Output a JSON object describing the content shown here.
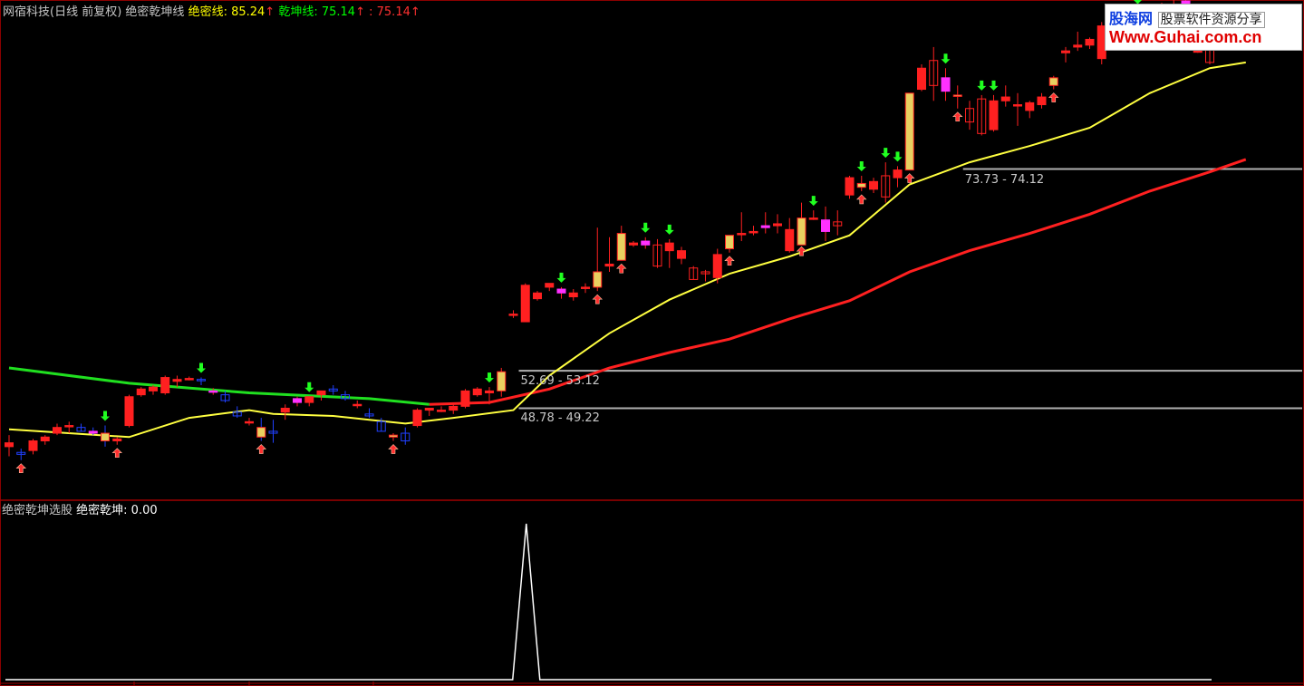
{
  "header": {
    "title": "网宿科技(日线 前复权) 绝密乾坤线",
    "line1_label": "绝密线: ",
    "line1_value": "85.24",
    "line2_label": "乾坤线: ",
    "line2_value": "75.14",
    "line3_label": ": ",
    "line3_value": "75.14",
    "up_arrow": "↑",
    "colors": {
      "title": "#c8c8c8",
      "line1": "#ffff00",
      "line2": "#00ff00",
      "line3": "#ff3030"
    }
  },
  "watermark": {
    "brand": "股海网",
    "slogan": "股票软件资源分享",
    "url": "Www.Guhai.com.cn"
  },
  "indicator": {
    "title": "绝密乾坤选股",
    "label": "绝密乾坤: ",
    "value": "0.00"
  },
  "range_labels": [
    {
      "text": "52.69 - 53.12",
      "price": 53.1
    },
    {
      "text": "48.78 - 49.22",
      "price": 49.2
    },
    {
      "text": "73.73 - 74.12",
      "price": 74.1
    }
  ],
  "chart_data": {
    "type": "candlestick",
    "price_range": [
      40,
      90
    ],
    "colors": {
      "up": "#ff2020",
      "down_early": "#2040ff",
      "ma_fast": "#ffff40",
      "ma_slow_green": "#20e020",
      "ma_slow_red": "#ff2020",
      "highlight_gold": "#e8d060",
      "highlight_magenta": "#ff30ff",
      "signal_down": "#20ff20",
      "signal_up": "#ff3030",
      "indicator_line": "#ffffff"
    },
    "candles": [
      [
        45.2,
        46.4,
        44.2,
        45.6
      ],
      [
        44.6,
        45.0,
        43.8,
        44.4
      ],
      [
        44.8,
        46.0,
        44.4,
        45.8
      ],
      [
        45.8,
        46.4,
        45.4,
        46.2
      ],
      [
        46.6,
        47.6,
        46.4,
        47.2
      ],
      [
        47.4,
        47.8,
        46.6,
        47.4
      ],
      [
        47.2,
        47.6,
        46.8,
        46.8
      ],
      [
        46.8,
        47.2,
        46.4,
        46.6
      ],
      [
        46.6,
        47.4,
        45.2,
        45.8
      ],
      [
        45.8,
        46.2,
        45.4,
        46.0
      ],
      [
        47.4,
        50.6,
        47.2,
        50.4
      ],
      [
        50.6,
        51.4,
        50.4,
        51.2
      ],
      [
        51.0,
        51.6,
        50.6,
        51.4
      ],
      [
        50.8,
        52.6,
        50.6,
        52.4
      ],
      [
        52.0,
        52.6,
        51.4,
        52.2
      ],
      [
        52.3,
        52.5,
        52.1,
        52.3
      ],
      [
        52.2,
        52.4,
        51.6,
        52.1
      ],
      [
        51.0,
        51.3,
        50.6,
        51.0
      ],
      [
        50.6,
        51.0,
        49.8,
        50.0
      ],
      [
        48.8,
        49.4,
        48.2,
        48.4
      ],
      [
        47.8,
        48.2,
        47.4,
        47.8
      ],
      [
        47.2,
        48.2,
        45.8,
        46.2
      ],
      [
        46.8,
        48.0,
        45.6,
        46.6
      ],
      [
        48.8,
        49.6,
        48.0,
        49.2
      ],
      [
        49.8,
        50.4,
        49.4,
        50.2
      ],
      [
        49.8,
        50.4,
        49.4,
        50.4
      ],
      [
        50.6,
        51.0,
        50.0,
        51.0
      ],
      [
        51.2,
        51.6,
        50.6,
        51.0
      ],
      [
        50.6,
        51.0,
        50.0,
        50.2
      ],
      [
        49.6,
        50.0,
        49.2,
        49.6
      ],
      [
        48.6,
        49.2,
        48.2,
        48.4
      ],
      [
        47.8,
        48.2,
        46.8,
        46.8
      ],
      [
        46.2,
        46.6,
        45.8,
        46.4
      ],
      [
        46.6,
        47.2,
        45.4,
        45.8
      ],
      [
        47.4,
        49.2,
        47.2,
        49.0
      ],
      [
        49.0,
        49.2,
        48.4,
        49.2
      ],
      [
        49.0,
        49.4,
        48.8,
        49.0
      ],
      [
        49.0,
        49.6,
        48.6,
        49.4
      ],
      [
        49.4,
        51.2,
        49.2,
        51.0
      ],
      [
        50.6,
        51.4,
        50.4,
        51.2
      ],
      [
        50.8,
        51.4,
        49.6,
        51.0
      ],
      [
        51.0,
        53.4,
        50.4,
        53.0
      ],
      [
        59.0,
        59.4,
        58.6,
        59.0
      ],
      [
        58.2,
        62.2,
        58.2,
        62.0
      ],
      [
        60.6,
        61.4,
        60.4,
        61.2
      ],
      [
        61.8,
        62.2,
        61.4,
        62.2
      ],
      [
        61.2,
        61.8,
        60.6,
        61.6
      ],
      [
        60.8,
        61.6,
        60.4,
        61.2
      ],
      [
        61.8,
        62.2,
        61.2,
        61.8
      ],
      [
        63.4,
        68.0,
        61.4,
        61.8
      ],
      [
        64.0,
        67.0,
        63.4,
        64.2
      ],
      [
        67.4,
        68.2,
        64.6,
        64.6
      ],
      [
        66.2,
        66.6,
        66.0,
        66.4
      ],
      [
        66.2,
        67.0,
        65.8,
        66.6
      ],
      [
        66.2,
        66.8,
        63.8,
        64.0
      ],
      [
        65.6,
        66.8,
        63.8,
        66.4
      ],
      [
        64.8,
        66.0,
        64.2,
        65.6
      ],
      [
        63.8,
        64.0,
        62.6,
        62.6
      ],
      [
        63.4,
        63.6,
        62.4,
        63.2
      ],
      [
        62.8,
        65.8,
        62.2,
        65.2
      ],
      [
        65.8,
        67.2,
        65.4,
        67.2
      ],
      [
        67.4,
        69.6,
        66.6,
        67.4
      ],
      [
        67.6,
        68.2,
        67.2,
        67.6
      ],
      [
        68.2,
        69.6,
        67.4,
        68.0
      ],
      [
        68.2,
        69.4,
        67.4,
        68.4
      ],
      [
        65.6,
        69.0,
        65.4,
        67.8
      ],
      [
        69.0,
        70.6,
        66.4,
        66.2
      ],
      [
        69.0,
        69.8,
        68.8,
        69.0
      ],
      [
        68.8,
        70.2,
        66.6,
        67.6
      ],
      [
        68.6,
        69.8,
        67.2,
        68.2
      ],
      [
        71.4,
        73.4,
        71.0,
        73.2
      ],
      [
        72.2,
        73.4,
        71.8,
        72.6
      ],
      [
        72.0,
        73.2,
        71.6,
        72.8
      ],
      [
        73.4,
        74.8,
        70.6,
        71.2
      ],
      [
        73.2,
        74.4,
        72.2,
        74.0
      ],
      [
        74.0,
        82.0,
        74.0,
        82.0
      ],
      [
        82.4,
        85.0,
        82.2,
        84.6
      ],
      [
        85.4,
        86.8,
        81.2,
        82.8
      ],
      [
        83.6,
        84.6,
        81.2,
        82.2
      ],
      [
        81.8,
        82.8,
        80.4,
        81.8
      ],
      [
        80.4,
        81.2,
        78.2,
        79.0
      ],
      [
        81.4,
        81.8,
        77.6,
        77.8
      ],
      [
        78.2,
        81.8,
        78.0,
        81.2
      ],
      [
        81.2,
        82.8,
        80.6,
        81.6
      ],
      [
        80.8,
        82.0,
        78.6,
        80.8
      ],
      [
        80.2,
        81.2,
        79.4,
        81.0
      ],
      [
        80.8,
        82.0,
        80.4,
        81.6
      ],
      [
        82.8,
        83.8,
        82.4,
        83.6
      ],
      [
        86.2,
        86.8,
        85.2,
        86.4
      ],
      [
        86.8,
        88.4,
        86.4,
        87.0
      ],
      [
        87.0,
        87.8,
        86.6,
        87.6
      ],
      [
        85.6,
        89.4,
        85.0,
        89.0
      ],
      [
        88.6,
        90.4,
        88.0,
        89.4
      ],
      [
        89.6,
        90.4,
        88.4,
        89.4
      ],
      [
        90.6,
        90.8,
        89.0,
        89.4
      ],
      [
        89.6,
        90.2,
        88.6,
        89.2
      ],
      [
        89.8,
        91.4,
        89.4,
        91.2
      ],
      [
        91.2,
        92.0,
        88.6,
        89.8
      ],
      [
        91.6,
        92.0,
        88.6,
        89.0
      ],
      [
        86.4,
        89.6,
        86.2,
        86.4
      ],
      [
        87.8,
        89.4,
        85.0,
        85.2
      ]
    ],
    "ma_fast": [
      [
        0,
        47.0
      ],
      [
        10,
        46.2
      ],
      [
        15,
        48.2
      ],
      [
        20,
        49.0
      ],
      [
        22,
        48.6
      ],
      [
        27,
        48.4
      ],
      [
        30,
        48.0
      ],
      [
        33,
        47.6
      ],
      [
        37,
        48.2
      ],
      [
        42,
        49.0
      ],
      [
        45,
        52.6
      ],
      [
        50,
        57.0
      ],
      [
        55,
        60.5
      ],
      [
        60,
        63.2
      ],
      [
        65,
        65.0
      ],
      [
        70,
        67.2
      ],
      [
        75,
        72.5
      ],
      [
        80,
        74.8
      ],
      [
        85,
        76.5
      ],
      [
        90,
        78.4
      ],
      [
        95,
        82.0
      ],
      [
        100,
        84.6
      ],
      [
        103,
        85.2
      ]
    ],
    "ma_slow": [
      [
        0,
        53.4
      ],
      [
        10,
        51.8
      ],
      [
        20,
        50.8
      ],
      [
        30,
        50.2
      ],
      [
        35,
        49.6
      ],
      [
        40,
        49.8
      ],
      [
        45,
        51.2
      ],
      [
        50,
        53.4
      ],
      [
        55,
        55.0
      ],
      [
        60,
        56.4
      ],
      [
        65,
        58.5
      ],
      [
        70,
        60.4
      ],
      [
        75,
        63.4
      ],
      [
        80,
        65.6
      ],
      [
        85,
        67.4
      ],
      [
        90,
        69.4
      ],
      [
        95,
        71.8
      ],
      [
        100,
        73.8
      ],
      [
        103,
        75.1
      ]
    ],
    "ma_slow_green_until": 37,
    "gold_bars": [
      8,
      21,
      32,
      41,
      49,
      51,
      60,
      66,
      71,
      75,
      79,
      87,
      93
    ],
    "magenta_bars": [
      7,
      17,
      24,
      46,
      53,
      63,
      68,
      78,
      92,
      96,
      98
    ],
    "down_signals": [
      8,
      16,
      25,
      40,
      46,
      53,
      55,
      67,
      71,
      73,
      74,
      78,
      81,
      82,
      94,
      98
    ],
    "up_signals": [
      1,
      9,
      21,
      32,
      49,
      51,
      60,
      66,
      71,
      75,
      79,
      87,
      93
    ],
    "indicator": {
      "peak_index": 43,
      "peak_value": 1.0,
      "baseline": 0.0
    }
  }
}
